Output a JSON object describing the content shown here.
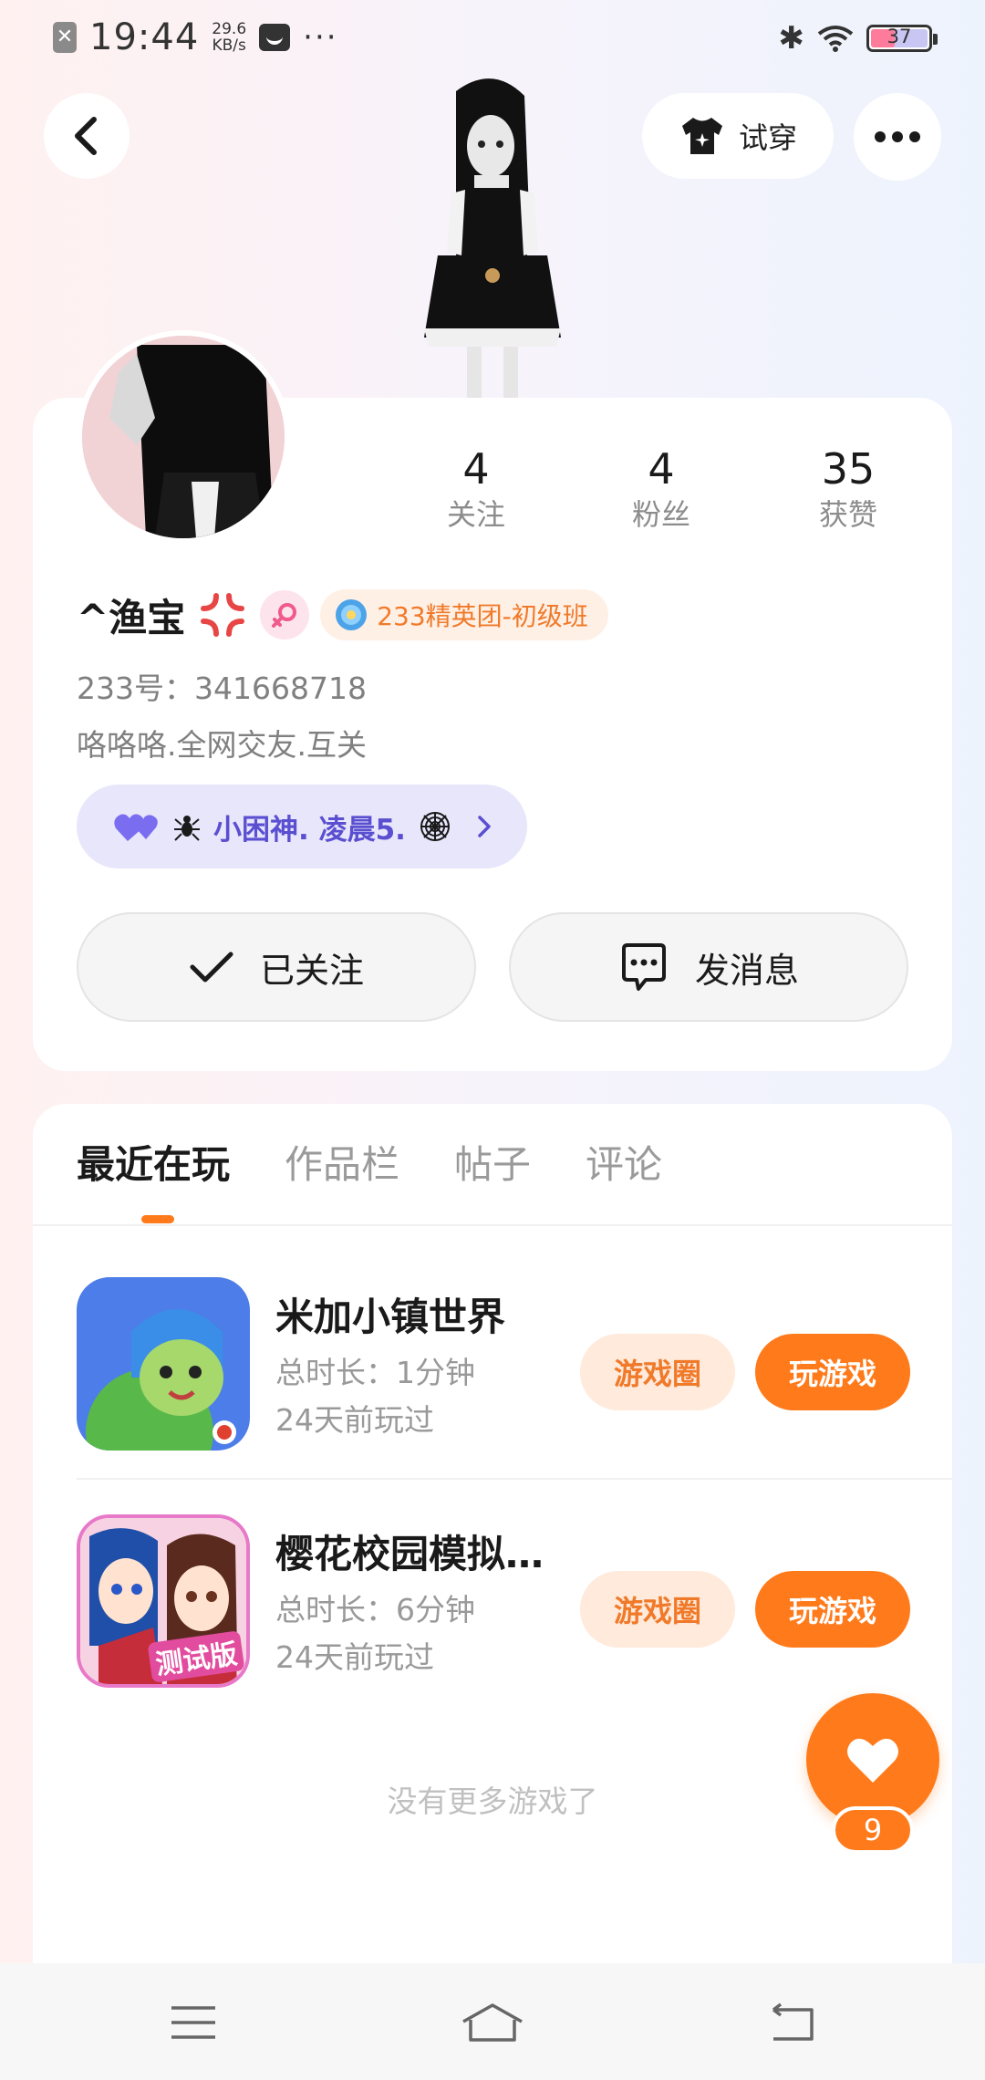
{
  "status_bar": {
    "time": "19:44",
    "speed_value": "29.6",
    "speed_unit": "KB/s",
    "battery": "37"
  },
  "header": {
    "tryon_label": "试穿"
  },
  "stats": [
    {
      "value": "4",
      "label": "关注"
    },
    {
      "value": "4",
      "label": "粉丝"
    },
    {
      "value": "35",
      "label": "获赞"
    }
  ],
  "profile": {
    "name": "^渔宝",
    "badge": "233精英团-初级班",
    "uid": "233号：341668718",
    "bio": "咯咯咯.全网交友.互关",
    "bond": "小困神. 凌晨5."
  },
  "actions": {
    "follow_label": "已关注",
    "message_label": "发消息"
  },
  "tabs": [
    "最近在玩",
    "作品栏",
    "帖子",
    "评论"
  ],
  "games": [
    {
      "title": "米加小镇世界",
      "duration": "总时长：1分钟",
      "last_played": "24天前玩过",
      "circle_label": "游戏圈",
      "play_label": "玩游戏"
    },
    {
      "title": "樱花校园模拟…",
      "duration": "总时长：6分钟",
      "last_played": "24天前玩过",
      "circle_label": "游戏圈",
      "play_label": "玩游戏",
      "icon_tag": "测试版"
    }
  ],
  "footer_text": "没有更多游戏了",
  "like_count": "9",
  "colors": {
    "accent": "#ff7a1a",
    "bond": "#5a4fd1"
  }
}
